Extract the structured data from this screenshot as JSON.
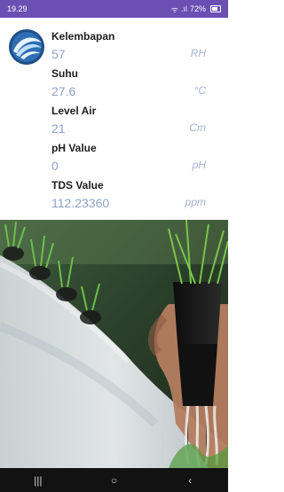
{
  "status_bar": {
    "time": "19.29",
    "battery": "72%"
  },
  "app": {
    "logo_icon": "app-logo-icon",
    "colors": {
      "status_bar": "#6b4fb3",
      "value_text": "#8fa0c8",
      "unit_text": "#a7b3d3",
      "nav_bar": "#121212"
    }
  },
  "sensors": [
    {
      "label": "Kelembapan",
      "value": "57",
      "unit": "RH"
    },
    {
      "label": "Suhu",
      "value": "27.6",
      "unit": "°C"
    },
    {
      "label": "Level Air",
      "value": "21",
      "unit": "Cm"
    },
    {
      "label": "pH Value",
      "value": "0",
      "unit": "pH"
    },
    {
      "label": "TDS Value",
      "value": "112.23360",
      "unit": "ppm"
    }
  ],
  "nav": {
    "recent_icon": "recent-apps-icon",
    "home_icon": "home-icon",
    "back_icon": "back-icon"
  }
}
